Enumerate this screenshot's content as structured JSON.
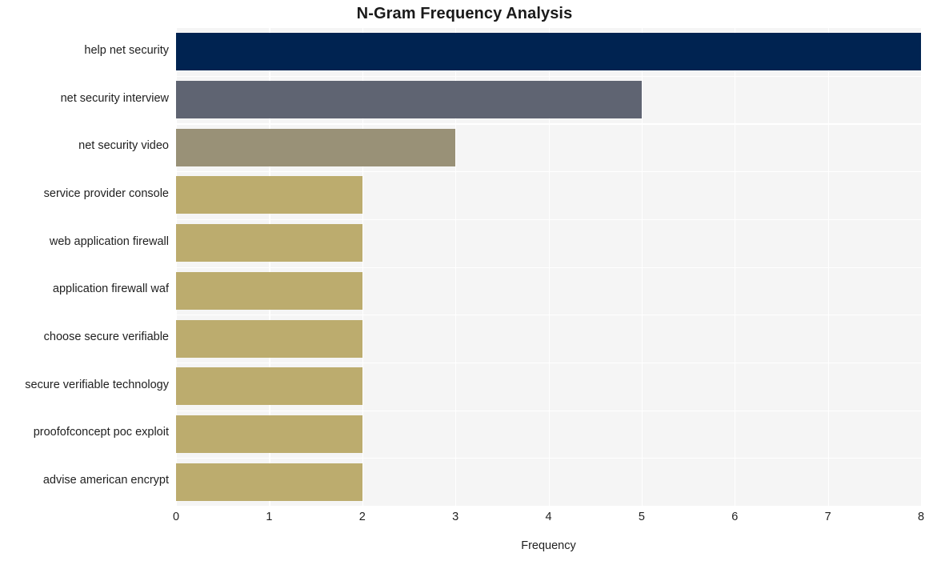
{
  "chart_data": {
    "type": "bar",
    "orientation": "horizontal",
    "title": "N-Gram Frequency Analysis",
    "xlabel": "Frequency",
    "ylabel": "",
    "categories": [
      "help net security",
      "net security interview",
      "net security video",
      "service provider console",
      "web application firewall",
      "application firewall waf",
      "choose secure verifiable",
      "secure verifiable technology",
      "proofofconcept poc exploit",
      "advise american encrypt"
    ],
    "values": [
      8,
      5,
      3,
      2,
      2,
      2,
      2,
      2,
      2,
      2
    ],
    "bar_colors": [
      "#002351",
      "#5f6472",
      "#999177",
      "#bcac6e",
      "#bcac6e",
      "#bcac6e",
      "#bcac6e",
      "#bcac6e",
      "#bcac6e",
      "#bcac6e"
    ],
    "xlim": [
      0,
      8
    ],
    "xticks": [
      0,
      1,
      2,
      3,
      4,
      5,
      6,
      7,
      8
    ],
    "xtick_labels": [
      "0",
      "1",
      "2",
      "3",
      "4",
      "5",
      "6",
      "7",
      "8"
    ],
    "grid": true,
    "grid_color": "#ffffff",
    "plot_background": "#f5f5f5",
    "figure_background": "#ffffff",
    "legend": null
  }
}
